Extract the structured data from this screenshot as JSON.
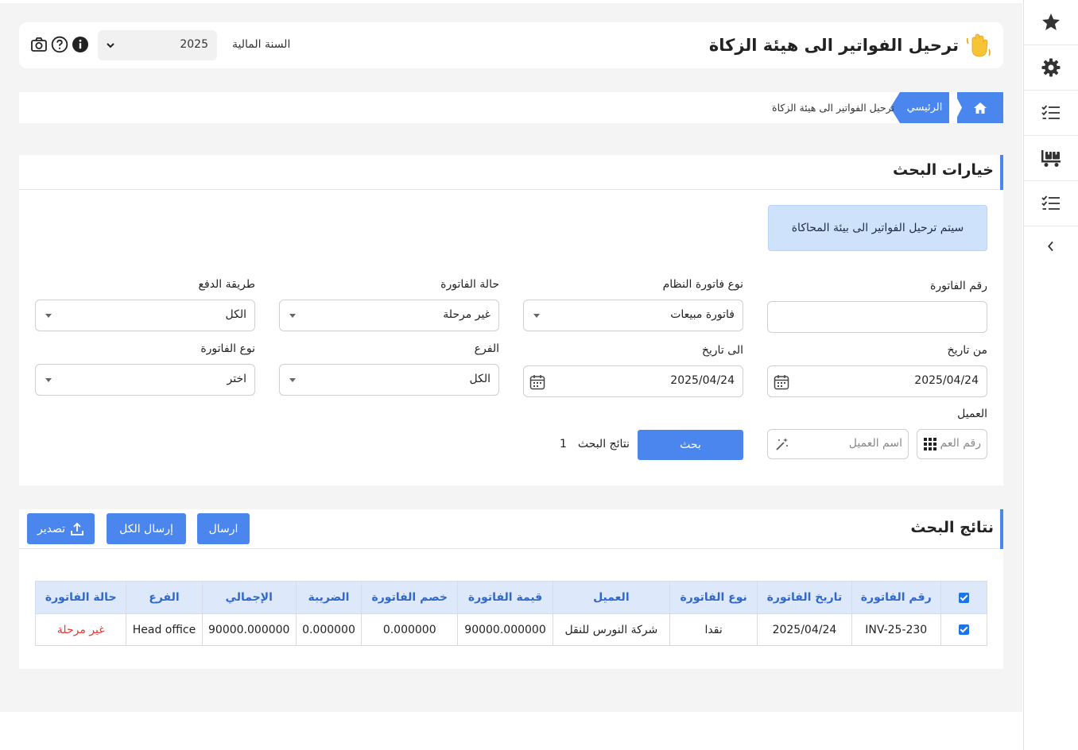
{
  "header": {
    "title": "ترحيل الفواتير الى هيئة الزكاة",
    "fiscal_year_label": "السنة المالية",
    "fiscal_year_value": "2025"
  },
  "breadcrumb": {
    "home": "الرئيسي",
    "current": "ترحيل الفواتير الى هيئة الزكاة"
  },
  "search": {
    "title": "خيارات البحث",
    "notice": "سيتم ترحيل الفواتير الى بيئة المحاكاة",
    "invoice_number_label": "رقم الفاتورة",
    "invoice_number_value": "",
    "system_invoice_type_label": "نوع فاتورة النظام",
    "system_invoice_type_value": "فاتورة مبيعات",
    "invoice_status_label": "حالة الفاتورة",
    "invoice_status_value": "غير مرحلة",
    "payment_method_label": "طريقة الدفع",
    "payment_method_value": "الكل",
    "from_date_label": "من تاريخ",
    "from_date_value": "2025/04/24",
    "to_date_label": "الى تاريخ",
    "to_date_value": "2025/04/24",
    "branch_label": "الفرع",
    "branch_value": "الكل",
    "invoice_kind_label": "نوع الفاتورة",
    "invoice_kind_value": "اختر",
    "customer_label": "العميل",
    "customer_number_placeholder": "رقم العم",
    "customer_name_placeholder": "اسم العميل",
    "search_button": "بحث",
    "results_label": "نتائج البحث",
    "results_count": "1"
  },
  "results": {
    "title": "نتائج البحث",
    "send_button": "ارسال",
    "send_all_button": "إرسال الكل",
    "export_button": "تصدير",
    "columns": [
      "رقم الفاتورة",
      "تاريخ الفاتورة",
      "نوع الفاتورة",
      "العميل",
      "قيمة الفاتورة",
      "خصم الفاتورة",
      "الضريبة",
      "الإجمالي",
      "الفرع",
      "حالة الفاتورة"
    ],
    "rows": [
      {
        "checked": true,
        "cells": [
          "INV-25-230",
          "2025/04/24",
          "نقدا",
          "شركة النورس للنقل",
          "90000.000000",
          "0.000000",
          "0.000000",
          "90000.000000",
          "Head office",
          "غير مرحلة"
        ]
      }
    ]
  },
  "sidebar": {
    "icons": [
      "star-icon",
      "gear-icon",
      "checklist-icon",
      "truck-icon",
      "checklist-icon",
      "chevron-left-icon"
    ]
  },
  "colors": {
    "accent": "#4b86ee",
    "table_header_bg": "#dde8fb",
    "notice_bg": "#cfe2fb",
    "status_red": "#e53935"
  }
}
